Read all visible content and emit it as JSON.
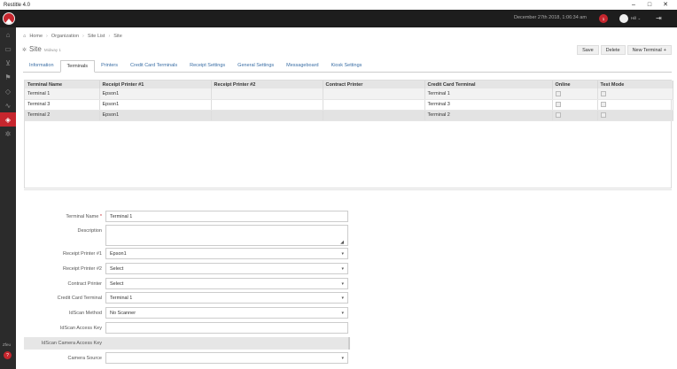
{
  "window": {
    "title": "Restitle 4.0",
    "controls": [
      "–",
      "□",
      "✕"
    ]
  },
  "header": {
    "datetime": "December 27th 2018, 1:06:34 am",
    "notifications": "1",
    "user": "Hill"
  },
  "sidebar": {
    "icons": [
      "home-icon",
      "monitor-icon",
      "cart-icon",
      "flag-icon",
      "tag-icon",
      "chart-icon",
      "shield-icon",
      "gear-icon"
    ],
    "help_label": "Zfeu",
    "help_badge": "?"
  },
  "breadcrumb": [
    "Home",
    "Organization",
    "Site List",
    "Site"
  ],
  "page": {
    "title": "Site",
    "subtitle": "Midway 1"
  },
  "actions": {
    "save": "Save",
    "delete": "Delete",
    "new_terminal": "New Terminal",
    "new_icon": "+"
  },
  "tabs": [
    "Information",
    "Terminals",
    "Printers",
    "Credit Card Terminals",
    "Receipt Settings",
    "General Settings",
    "Messageboard",
    "Kiosk Settings"
  ],
  "active_tab": 1,
  "table": {
    "columns": [
      "Terminal Name",
      "Receipt Printer #1",
      "Receipt Printer #2",
      "Contract Printer",
      "Credit Card Terminal",
      "Online",
      "Test Mode"
    ],
    "rows": [
      [
        "Terminal 1",
        "Epson1",
        "",
        "",
        "Terminal 1"
      ],
      [
        "Terminal 3",
        "Epson1",
        "",
        "",
        "Terminal 3"
      ],
      [
        "Terminal 2",
        "Epson1",
        "",
        "",
        "Terminal 2"
      ]
    ]
  },
  "form": {
    "terminal_name": {
      "label": "Terminal Name",
      "required": "*",
      "value": "Terminal 1"
    },
    "description": {
      "label": "Description",
      "value": ""
    },
    "receipt_printer_1": {
      "label": "Receipt Printer #1",
      "value": "Epson1"
    },
    "receipt_printer_2": {
      "label": "Receipt Printer #2",
      "value": "Select"
    },
    "contract_printer": {
      "label": "Contract Printer",
      "value": "Select"
    },
    "credit_card_terminal": {
      "label": "Credit Card Terminal",
      "value": "Terminal 1"
    },
    "idscan_method": {
      "label": "IdScan Method",
      "value": "No Scanner"
    },
    "idscan_access_key": {
      "label": "IdScan Access Key",
      "value": ""
    },
    "idscan_camera_access_key": {
      "label": "IdScan Camera Access Key",
      "value": ""
    },
    "camera_source": {
      "label": "Camera Source",
      "value": ""
    }
  }
}
